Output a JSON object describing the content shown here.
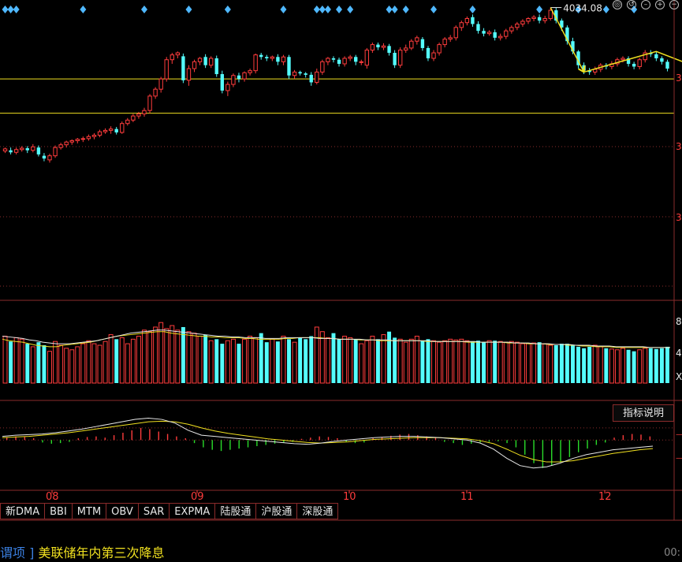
{
  "chart_data": {
    "type": "candlestick",
    "price_annotation": "4034.08",
    "price_hlines": [
      3930,
      3880
    ],
    "candles": [
      [
        3825,
        3828,
        3822,
        3830
      ],
      [
        3826,
        3823,
        3820,
        3830
      ],
      [
        3823,
        3827,
        3820,
        3830
      ],
      [
        3827,
        3829,
        3824,
        3832
      ],
      [
        3829,
        3826,
        3822,
        3832
      ],
      [
        3826,
        3831,
        3823,
        3835
      ],
      [
        3830,
        3820,
        3817,
        3833
      ],
      [
        3818,
        3814,
        3810,
        3822
      ],
      [
        3812,
        3818,
        3808,
        3821
      ],
      [
        3818,
        3830,
        3815,
        3833
      ],
      [
        3830,
        3834,
        3827,
        3837
      ],
      [
        3834,
        3838,
        3830,
        3840
      ],
      [
        3838,
        3840,
        3834,
        3842
      ],
      [
        3840,
        3842,
        3836,
        3844
      ],
      [
        3842,
        3843,
        3838,
        3846
      ],
      [
        3843,
        3846,
        3840,
        3849
      ],
      [
        3846,
        3848,
        3842,
        3851
      ],
      [
        3848,
        3853,
        3845,
        3856
      ],
      [
        3853,
        3855,
        3850,
        3858
      ],
      [
        3855,
        3857,
        3850,
        3861
      ],
      [
        3857,
        3852,
        3849,
        3860
      ],
      [
        3852,
        3865,
        3850,
        3868
      ],
      [
        3865,
        3870,
        3862,
        3873
      ],
      [
        3870,
        3876,
        3867,
        3879
      ],
      [
        3876,
        3879,
        3872,
        3882
      ],
      [
        3879,
        3884,
        3875,
        3888
      ],
      [
        3884,
        3905,
        3880,
        3908
      ],
      [
        3905,
        3915,
        3901,
        3918
      ],
      [
        3915,
        3930,
        3910,
        3933
      ],
      [
        3930,
        3958,
        3926,
        3962
      ],
      [
        3958,
        3965,
        3952,
        3968
      ],
      [
        3965,
        3968,
        3960,
        3970
      ],
      [
        3963,
        3928,
        3924,
        3967
      ],
      [
        3928,
        3945,
        3920,
        3950
      ],
      [
        3945,
        3955,
        3940,
        3958
      ],
      [
        3955,
        3960,
        3950,
        3962
      ],
      [
        3962,
        3950,
        3946,
        3966
      ],
      [
        3950,
        3960,
        3946,
        3963
      ],
      [
        3960,
        3937,
        3933,
        3964
      ],
      [
        3937,
        3913,
        3909,
        3942
      ],
      [
        3913,
        3922,
        3905,
        3926
      ],
      [
        3922,
        3935,
        3918,
        3938
      ],
      [
        3935,
        3930,
        3925,
        3939
      ],
      [
        3930,
        3939,
        3926,
        3941
      ],
      [
        3939,
        3942,
        3935,
        3945
      ],
      [
        3942,
        3965,
        3938,
        3967
      ],
      [
        3965,
        3962,
        3958,
        3968
      ],
      [
        3962,
        3960,
        3956,
        3965
      ],
      [
        3960,
        3962,
        3956,
        3964
      ],
      [
        3962,
        3955,
        3950,
        3966
      ],
      [
        3955,
        3962,
        3950,
        3965
      ],
      [
        3962,
        3935,
        3930,
        3965
      ],
      [
        3935,
        3940,
        3930,
        3943
      ],
      [
        3940,
        3938,
        3935,
        3942
      ],
      [
        3938,
        3936,
        3932,
        3940
      ],
      [
        3936,
        3925,
        3920,
        3940
      ],
      [
        3925,
        3940,
        3922,
        3945
      ],
      [
        3940,
        3955,
        3936,
        3958
      ],
      [
        3955,
        3960,
        3950,
        3962
      ],
      [
        3960,
        3958,
        3954,
        3963
      ],
      [
        3958,
        3952,
        3948,
        3961
      ],
      [
        3952,
        3960,
        3948,
        3963
      ],
      [
        3960,
        3962,
        3956,
        3965
      ],
      [
        3962,
        3955,
        3950,
        3965
      ],
      [
        3955,
        3955,
        3950,
        3958
      ],
      [
        3950,
        3972,
        3945,
        3975
      ],
      [
        3972,
        3980,
        3968,
        3983
      ],
      [
        3980,
        3976,
        3972,
        3983
      ],
      [
        3976,
        3978,
        3972,
        3982
      ],
      [
        3978,
        3968,
        3964,
        3981
      ],
      [
        3968,
        3950,
        3946,
        3972
      ],
      [
        3950,
        3972,
        3946,
        3976
      ],
      [
        3972,
        3975,
        3968,
        3980
      ],
      [
        3975,
        3985,
        3972,
        3988
      ],
      [
        3985,
        3990,
        3980,
        3993
      ],
      [
        3988,
        3975,
        3971,
        3991
      ],
      [
        3975,
        3960,
        3956,
        3978
      ],
      [
        3960,
        3968,
        3956,
        3972
      ],
      [
        3968,
        3980,
        3964,
        3983
      ],
      [
        3980,
        3988,
        3976,
        3991
      ],
      [
        3988,
        3990,
        3984,
        3994
      ],
      [
        3990,
        4005,
        3986,
        4008
      ],
      [
        4005,
        4012,
        4000,
        4015
      ],
      [
        4012,
        4018,
        4008,
        4021
      ],
      [
        4020,
        4010,
        4006,
        4024
      ],
      [
        4010,
        4000,
        3996,
        4014
      ],
      [
        4000,
        3996,
        3992,
        4004
      ],
      [
        3996,
        3998,
        3993,
        4001
      ],
      [
        3998,
        3990,
        3986,
        4002
      ],
      [
        3990,
        3992,
        3986,
        3996
      ],
      [
        3992,
        4000,
        3988,
        4003
      ],
      [
        4000,
        4005,
        3996,
        4008
      ],
      [
        4005,
        4010,
        4001,
        4013
      ],
      [
        4010,
        4014,
        4006,
        4017
      ],
      [
        4014,
        4018,
        4010,
        4020
      ],
      [
        4018,
        4020,
        4014,
        4023
      ],
      [
        4020,
        4015,
        4011,
        4024
      ],
      [
        4015,
        4018,
        4011,
        4022
      ],
      [
        4018,
        4030,
        4015,
        4034
      ],
      [
        4030,
        4015,
        4011,
        4034
      ],
      [
        4015,
        4005,
        4000,
        4018
      ],
      [
        4005,
        3985,
        3980,
        4008
      ],
      [
        3985,
        3970,
        3966,
        3990
      ],
      [
        3970,
        3950,
        3945,
        3972
      ],
      [
        3950,
        3942,
        3937,
        3954
      ],
      [
        3942,
        3940,
        3936,
        3946
      ],
      [
        3940,
        3944,
        3936,
        3948
      ],
      [
        3944,
        3950,
        3940,
        3953
      ],
      [
        3950,
        3948,
        3944,
        3953
      ],
      [
        3948,
        3952,
        3944,
        3956
      ],
      [
        3952,
        3958,
        3948,
        3961
      ],
      [
        3958,
        3960,
        3954,
        3963
      ],
      [
        3960,
        3952,
        3948,
        3963
      ],
      [
        3952,
        3948,
        3944,
        3955
      ],
      [
        3948,
        3958,
        3944,
        3961
      ],
      [
        3958,
        3968,
        3954,
        3972
      ],
      [
        3968,
        3966,
        3962,
        3972
      ],
      [
        3966,
        3960,
        3956,
        3970
      ],
      [
        3960,
        3955,
        3951,
        3963
      ],
      [
        3955,
        3945,
        3941,
        3958
      ]
    ],
    "volume_axis": [
      "8",
      "4",
      "X"
    ],
    "volume_ylim": [
      0,
      100
    ],
    "volume": [
      62,
      55,
      60,
      58,
      52,
      48,
      54,
      50,
      42,
      55,
      50,
      46,
      44,
      48,
      52,
      56,
      52,
      50,
      55,
      64,
      58,
      60,
      52,
      58,
      62,
      70,
      68,
      74,
      80,
      72,
      76,
      70,
      74,
      68,
      66,
      62,
      64,
      56,
      58,
      52,
      56,
      58,
      52,
      58,
      62,
      60,
      66,
      54,
      58,
      55,
      62,
      58,
      54,
      60,
      58,
      62,
      74,
      68,
      60,
      66,
      58,
      62,
      60,
      58,
      52,
      56,
      62,
      58,
      64,
      68,
      60,
      58,
      54,
      58,
      62,
      56,
      58,
      56,
      54,
      56,
      58,
      57,
      58,
      56,
      55,
      56,
      54,
      56,
      56,
      55,
      54,
      55,
      54,
      52,
      52,
      53,
      54,
      52,
      50,
      50,
      52,
      52,
      50,
      48,
      46,
      48,
      50,
      48,
      46,
      45,
      44,
      46,
      44,
      42,
      44,
      46,
      46,
      45,
      46,
      48
    ],
    "volume_ma": [
      [
        58,
        56,
        55,
        54,
        52,
        50,
        49,
        48,
        48,
        50,
        51,
        52,
        53,
        54,
        56,
        58,
        60,
        62,
        63,
        64,
        65,
        66,
        67,
        68,
        68,
        66,
        65,
        64,
        63,
        62,
        62,
        61,
        61,
        60,
        60,
        60,
        59,
        59,
        58,
        58,
        58,
        58,
        59,
        59,
        60,
        60,
        60,
        60,
        59,
        59,
        58,
        58,
        58,
        57,
        57,
        57,
        56,
        56,
        56,
        56,
        56,
        56,
        56,
        55,
        55,
        55,
        55,
        55,
        55,
        54,
        54,
        54,
        54,
        54,
        54,
        53,
        53,
        53,
        52,
        52,
        52,
        51,
        51,
        51,
        50,
        50,
        49,
        49,
        48,
        48,
        48,
        47,
        47,
        47,
        47,
        47,
        47,
        47,
        47,
        47
      ],
      [
        62,
        61,
        60,
        59,
        57,
        56,
        54,
        53,
        52,
        52,
        52,
        53,
        54,
        55,
        56,
        58,
        60,
        62,
        64,
        66,
        67,
        68,
        69,
        70,
        70,
        69,
        68,
        67,
        66,
        65,
        64,
        63,
        62,
        62,
        61,
        61,
        60,
        60,
        60,
        59,
        59,
        59,
        60,
        60,
        60,
        60,
        60,
        59,
        59,
        59,
        58,
        58,
        58,
        58,
        57,
        57,
        57,
        57,
        56,
        56,
        56,
        56,
        56,
        56,
        55,
        55,
        55,
        55,
        55,
        55,
        55,
        54,
        54,
        54,
        54,
        54,
        53,
        53,
        53,
        52,
        52,
        52,
        51,
        51,
        51,
        50,
        50,
        50,
        49,
        49,
        49,
        48,
        48,
        48,
        48,
        48,
        47,
        47,
        47,
        47
      ]
    ],
    "osc_ylim": [
      -8,
      6
    ],
    "osc_dif": [
      0.6,
      0.8,
      0.9,
      1.0,
      1.2,
      1.5,
      1.8,
      2.2,
      2.6,
      3.0,
      3.4,
      3.6,
      3.4,
      2.8,
      1.6,
      0.8,
      0.6,
      0.4,
      0.2,
      0.0,
      -0.2,
      -0.4,
      -0.6,
      -0.7,
      -0.5,
      -0.2,
      0.0,
      0.2,
      0.4,
      0.5,
      0.6,
      0.6,
      0.5,
      0.4,
      0.2,
      0.0,
      -0.5,
      -1.5,
      -3.0,
      -4.2,
      -4.6,
      -4.4,
      -3.8,
      -3.0,
      -2.4,
      -2.0,
      -1.6,
      -1.4,
      -1.2,
      -1.0
    ],
    "osc_dea": [
      0.4,
      0.5,
      0.6,
      0.8,
      1.0,
      1.2,
      1.5,
      1.8,
      2.1,
      2.4,
      2.7,
      3.0,
      3.1,
      3.0,
      2.6,
      2.0,
      1.5,
      1.1,
      0.8,
      0.5,
      0.2,
      0.0,
      -0.2,
      -0.4,
      -0.5,
      -0.4,
      -0.3,
      -0.1,
      0.1,
      0.2,
      0.3,
      0.4,
      0.4,
      0.4,
      0.3,
      0.2,
      -0.1,
      -0.6,
      -1.5,
      -2.5,
      -3.2,
      -3.6,
      -3.6,
      -3.4,
      -3.0,
      -2.6,
      -2.2,
      -1.9,
      -1.6,
      -1.4
    ],
    "osc_hist": [
      0.4,
      0.6,
      0.5,
      0.3,
      -0.4,
      -0.6,
      -0.5,
      -0.3,
      0.3,
      0.5,
      0.6,
      0.4,
      0.8,
      1.2,
      1.6,
      2.0,
      1.8,
      1.4,
      1.0,
      0.6,
      0.3,
      -0.5,
      -1.2,
      -1.6,
      -1.8,
      -1.6,
      -1.4,
      -1.2,
      -1.0,
      -0.8,
      -0.6,
      -0.4,
      -0.3,
      0.2,
      0.4,
      0.6,
      0.5,
      0.3,
      -0.3,
      -0.5,
      -0.4,
      0.3,
      0.5,
      0.7,
      0.9,
      1.0,
      0.8,
      0.6,
      0.4,
      -0.3,
      -0.5,
      -0.8,
      -0.6,
      -0.4,
      -0.3,
      -0.2,
      -0.5,
      -1.2,
      -2.4,
      -3.8,
      -4.6,
      -4.2,
      -3.6,
      -2.8,
      -2.0,
      -1.4,
      -0.8,
      -0.4,
      0.4,
      0.8,
      1.0,
      0.9,
      0.6
    ],
    "x_tick_labels": [
      "08",
      "09",
      "10",
      "11",
      "12"
    ],
    "right_axis_labels": [
      "3",
      "3",
      "3"
    ]
  },
  "indicator_button": "指标说明",
  "tabs": [
    "新DMA",
    "BBI",
    "MTM",
    "OBV",
    "SAR",
    "EXPMA",
    "陆股通",
    "沪股通",
    "深股通"
  ],
  "news": {
    "prefix": "谓项  ]",
    "text": "美联储年内第三次降息",
    "time": "00:"
  },
  "colors": {
    "up": "#ff3c3c",
    "down": "#54fcfc",
    "yellow": "#f0e020",
    "white": "#e8e8e8",
    "grid": "#8a2b2b"
  },
  "icons": [
    "settings-icon",
    "reset-icon",
    "hide-icon",
    "zoom-in-icon",
    "zoom-out-icon"
  ]
}
